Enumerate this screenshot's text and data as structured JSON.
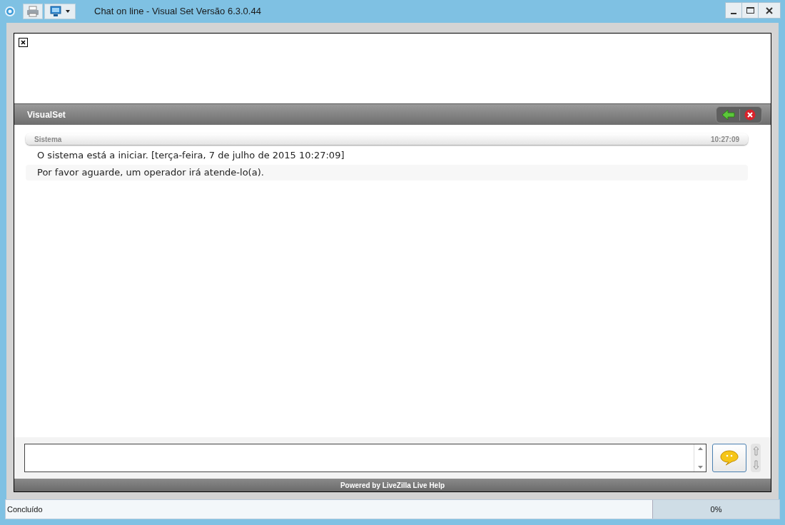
{
  "window": {
    "title": "Chat on line - Visual Set Versão 6.3.0.44"
  },
  "chat": {
    "title": "VisualSet",
    "header": {
      "sender": "Sistema",
      "time": "10:27:09"
    },
    "messages": [
      "O sistema está a iniciar. [terça-feira, 7 de julho de 2015 10:27:09]",
      "Por favor aguarde, um operador irá atende-lo(a)."
    ],
    "footer": "Powered by LiveZilla Live Help"
  },
  "status_bar": {
    "text": "Concluído",
    "progress": {
      "reading": "0%",
      "level": 0
    }
  }
}
